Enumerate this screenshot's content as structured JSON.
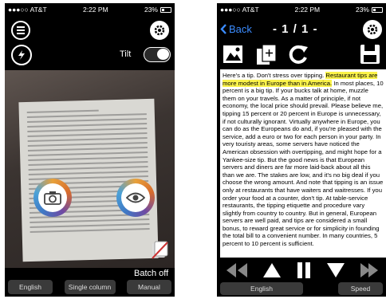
{
  "status_left": {
    "carrier": "●●●○○ AT&T",
    "time": "2:22 PM",
    "battery": "23%"
  },
  "status_right": {
    "carrier": "●●●○○ AT&T",
    "time": "2:22 PM",
    "battery": "23%"
  },
  "camera_screen": {
    "tilt_label": "Tilt",
    "tilt_on": false,
    "batch_label": "Batch off",
    "bottom_buttons": [
      "English",
      "Single column",
      "Manual"
    ]
  },
  "reader_screen": {
    "back_label": "Back",
    "page_indicator": "- 1 / 1 -",
    "text_before": "Here's a tip. Don't stress over tipping. ",
    "text_highlight": "Restaurant tips are more modest in Europe than in America.",
    "text_after": " In most places, 10 percent is a big tip. If your bucks talk at home, muzzle them on your travels. As a matter of principle, if not economy, the local price should prevail. Please believe me, tipping 15 percent or 20 percent in Europe is unnecessary, if not culturally ignorant. Virtually anywhere in Europe, you can do as the Europeans do and, if you're pleased with the service, add a euro or two for each person in your party. In very touristy areas, some servers have noticed the American obsession with overtipping, and might hope for a Yankee-size tip. But the good news is that European servers and diners are far more laid-back about all this than we are. The stakes are low, and it's no big deal if you choose the wrong amount. And note that tipping is an issue only at restaurants that have waiters and waitresses. If you order your food at a counter, don't tip. At table-service restaurants, the tipping etiquette and procedure vary slightly from country to country. But in general, European servers are well paid, and tips are considered a small bonus, to reward great service or for simplicity in founding the total bill to a convenient number. In many countries, 5 percent to 10 percent is sufficient.",
    "bottom_buttons": [
      "English",
      "Speed"
    ]
  },
  "colors": {
    "accent": "#3b8cff",
    "highlight": "#fbf34a",
    "pill": "#3a3a3a"
  },
  "icons": [
    "menu-icon",
    "settings-gear-icon",
    "flash-icon",
    "camera-icon",
    "eye-icon",
    "batch-icon",
    "back-chevron-icon",
    "image-icon",
    "add-page-icon",
    "refresh-icon",
    "save-icon",
    "rewind-icon",
    "up-icon",
    "pause-icon",
    "down-icon",
    "forward-icon"
  ]
}
